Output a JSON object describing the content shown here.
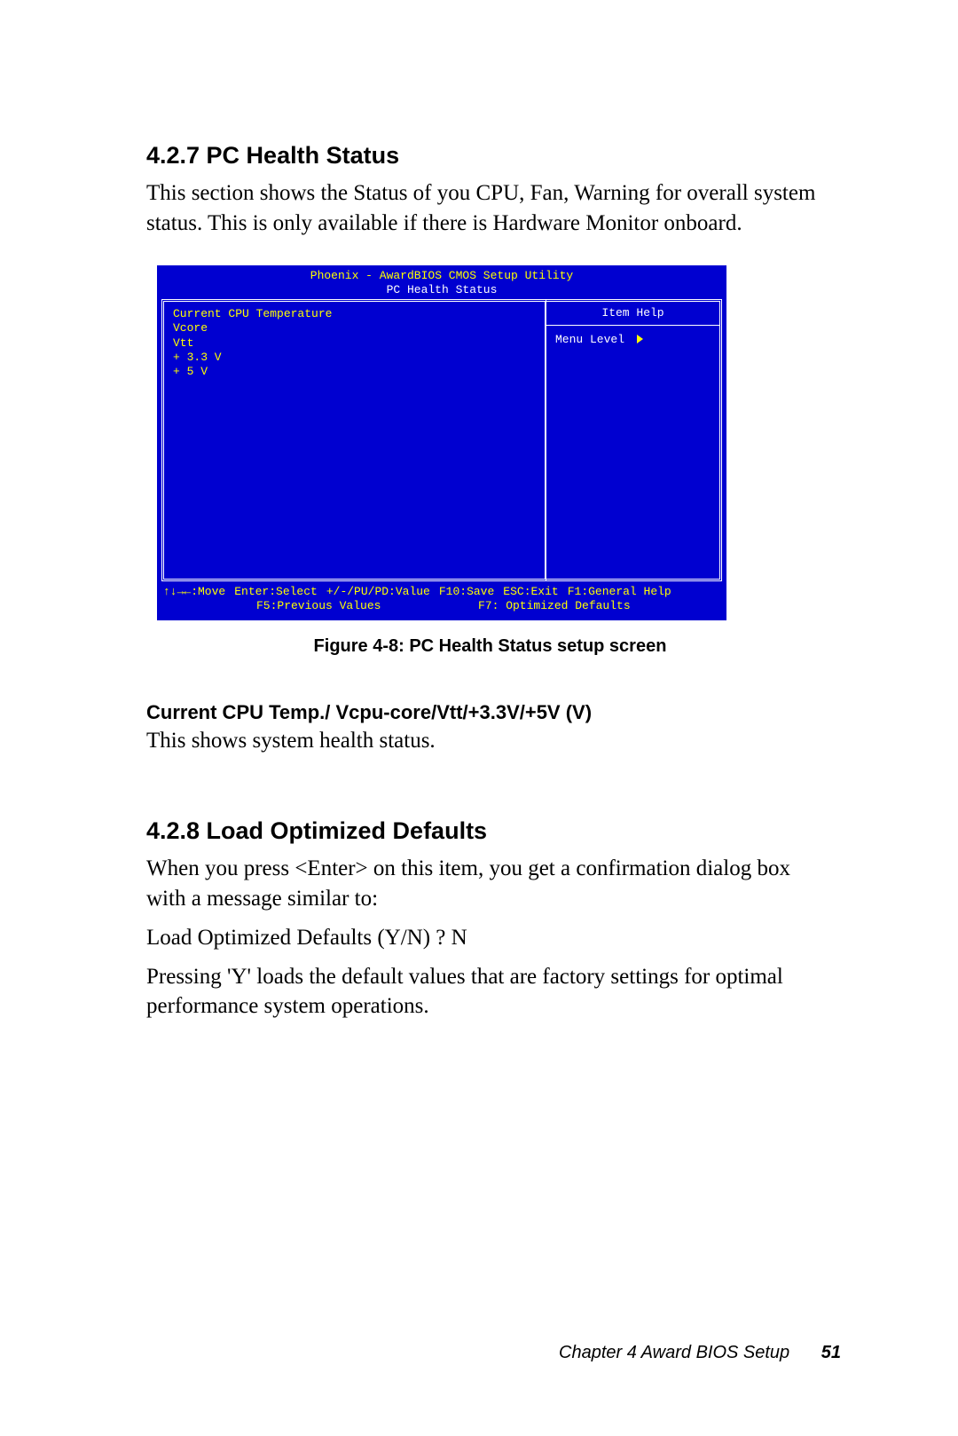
{
  "section_427": {
    "heading": "4.2.7 PC Health Status",
    "para": "This section shows the Status of you CPU, Fan, Warning for overall system status. This is only available if there is Hardware Monitor onboard."
  },
  "bios": {
    "title_line1": "Phoenix - AwardBIOS CMOS Setup Utility",
    "title_line2": "PC Health Status",
    "left_items": [
      "Current CPU Temperature",
      "Vcore",
      "Vtt",
      "+ 3.3 V",
      "+ 5 V"
    ],
    "help_head": "Item Help",
    "menu_level": "Menu Level",
    "footer1": {
      "move": "↑↓→←:Move",
      "enter": "Enter:Select",
      "pupd": "+/-/PU/PD:Value",
      "f10": "F10:Save",
      "esc": "ESC:Exit",
      "f1": "F1:General Help"
    },
    "footer2": {
      "f5": "F5:Previous Values",
      "f7": "F7: Optimized Defaults"
    }
  },
  "figure_caption": "Figure 4-8: PC Health Status setup screen",
  "sub": {
    "heading": "Current CPU Temp./ Vcpu-core/Vtt/+3.3V/+5V (V)",
    "text": "This shows system health status."
  },
  "section_428": {
    "heading": "4.2.8 Load Optimized Defaults",
    "p1": "When you press <Enter> on this item, you get a confirmation dialog box with a message similar to:",
    "p2": "Load Optimized Defaults (Y/N) ? N",
    "p3": "Pressing 'Y' loads the default values that are factory settings for optimal performance system operations."
  },
  "footer": {
    "chapter": "Chapter 4  Award BIOS Setup",
    "page": "51"
  }
}
